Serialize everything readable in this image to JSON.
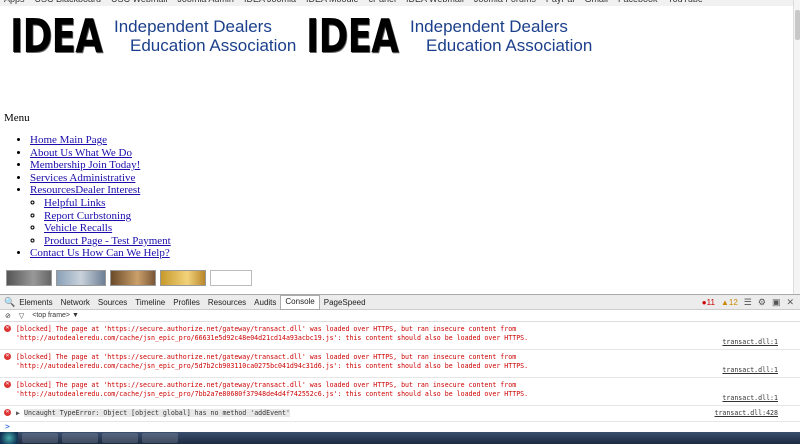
{
  "bookmarks": [
    "Apps",
    "USC Blackboard",
    "USC Webmail",
    "Joomla Admin",
    "IDEA Joomla",
    "IDEA Moodle",
    "cPanel",
    "IDEA Webmail",
    "Joomla Forums",
    "PayPal",
    "Gmail",
    "Facebook",
    "YouTube"
  ],
  "logo": {
    "mark": "IDEA",
    "line1": "Independent Dealers",
    "line2": "Education Association"
  },
  "menu": {
    "title": "Menu",
    "items": [
      {
        "label": "Home Main Page"
      },
      {
        "label": "About Us What We Do"
      },
      {
        "label": "Membership Join Today!"
      },
      {
        "label": "Services Administrative"
      },
      {
        "label": "ResourcesDealer Interest"
      },
      {
        "label": "Contact Us How Can We Help?"
      }
    ],
    "sub_items": [
      {
        "label": "Helpful Links"
      },
      {
        "label": "Report Curbstoning"
      },
      {
        "label": "Vehicle Recalls"
      },
      {
        "label": "Product Page - Test Payment"
      }
    ]
  },
  "devtools": {
    "tabs": [
      "Elements",
      "Network",
      "Sources",
      "Timeline",
      "Profiles",
      "Resources",
      "Audits",
      "Console",
      "PageSpeed"
    ],
    "active_tab": "Console",
    "error_count": "11",
    "warning_count": "12",
    "frame_selector": "<top frame>",
    "messages": [
      {
        "line1": "[blocked] The page at 'https://secure.authorize.net/gateway/transact.dll' was loaded over HTTPS, but ran insecure content from",
        "line2": "'http://autodealeredu.com/cache/jsn_epic_pro/66631e5d92c48e04d21cd14a93acbc19.js': this content should also be loaded over HTTPS.",
        "source": "transact.dll:1"
      },
      {
        "line1": "[blocked] The page at 'https://secure.authorize.net/gateway/transact.dll' was loaded over HTTPS, but ran insecure content from",
        "line2": "'http://autodealeredu.com/cache/jsn_epic_pro/5d7b2cb903110ca0275bc041d94c31d6.js': this content should also be loaded over HTTPS.",
        "source": "transact.dll:1"
      },
      {
        "line1": "[blocked] The page at 'https://secure.authorize.net/gateway/transact.dll' was loaded over HTTPS, but ran insecure content from",
        "line2": "'http://autodealeredu.com/cache/jsn_epic_pro/7bb2a7e80680f37948de4d4f742552c6.js': this content should also be loaded over HTTPS.",
        "source": "transact.dll:1"
      }
    ],
    "type_error": {
      "text": "Uncaught TypeError: Object [object global] has no method 'addEvent'",
      "source": "transact.dll:428"
    },
    "prompt": ">"
  }
}
